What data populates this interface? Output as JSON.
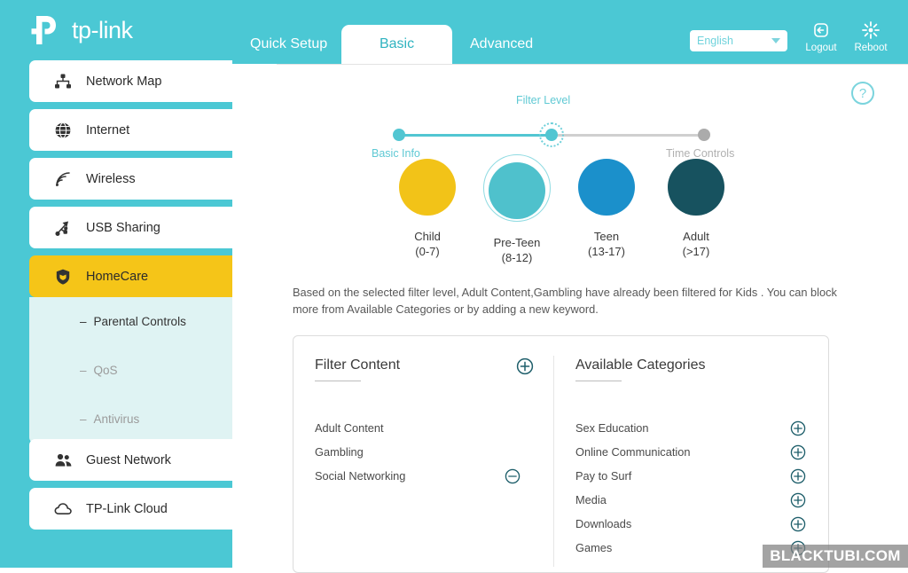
{
  "header": {
    "brand": "tp-link",
    "tabs": [
      {
        "label": "Quick Setup",
        "active": false
      },
      {
        "label": "Basic",
        "active": true
      },
      {
        "label": "Advanced",
        "active": false
      }
    ],
    "language": "English",
    "logout_label": "Logout",
    "reboot_label": "Reboot"
  },
  "sidebar": {
    "items": [
      {
        "label": "Network Map",
        "icon": "network-map-icon"
      },
      {
        "label": "Internet",
        "icon": "globe-icon"
      },
      {
        "label": "Wireless",
        "icon": "wireless-signal-icon"
      },
      {
        "label": "USB Sharing",
        "icon": "usb-icon"
      },
      {
        "label": "HomeCare",
        "icon": "shield-icon",
        "active": true
      },
      {
        "label": "Guest Network",
        "icon": "users-icon"
      },
      {
        "label": "TP-Link Cloud",
        "icon": "cloud-icon"
      }
    ],
    "submenu": [
      {
        "label": "Parental Controls",
        "active": true
      },
      {
        "label": "QoS",
        "active": false
      },
      {
        "label": "Antivirus",
        "active": false
      }
    ],
    "dash": "–"
  },
  "main": {
    "help_icon_label": "?",
    "stepper": {
      "steps": [
        {
          "label": "Basic Info",
          "state": "done"
        },
        {
          "label": "Filter Level",
          "state": "current"
        },
        {
          "label": "Time Controls",
          "state": "pending"
        }
      ]
    },
    "levels": [
      {
        "name": "Child",
        "age": "(0-7)",
        "color": "#F2C318",
        "selected": false
      },
      {
        "name": "Pre-Teen",
        "age": "(8-12)",
        "color": "#4FC1CC",
        "selected": true
      },
      {
        "name": "Teen",
        "age": "(13-17)",
        "color": "#1B90CB",
        "selected": false
      },
      {
        "name": "Adult",
        "age": "(>17)",
        "color": "#17525F",
        "selected": false
      }
    ],
    "description": "Based on the selected filter level, Adult Content,Gambling have already been filtered for Kids . You can block more from Available Categories or by adding a new keyword.",
    "filter_content": {
      "title": "Filter Content",
      "add_icon": "plus-circle-icon",
      "items": [
        {
          "label": "Adult Content",
          "action": null
        },
        {
          "label": "Gambling",
          "action": null
        },
        {
          "label": "Social Networking",
          "action": "minus-circle-icon"
        }
      ]
    },
    "available_categories": {
      "title": "Available Categories",
      "items": [
        {
          "label": "Sex Education",
          "action": "plus-circle-icon"
        },
        {
          "label": "Online Communication",
          "action": "plus-circle-icon"
        },
        {
          "label": "Pay to Surf",
          "action": "plus-circle-icon"
        },
        {
          "label": "Media",
          "action": "plus-circle-icon"
        },
        {
          "label": "Downloads",
          "action": "plus-circle-icon"
        },
        {
          "label": "Games",
          "action": "plus-circle-icon"
        }
      ]
    }
  },
  "watermark": {
    "text": "BLACKTUBI.COM"
  },
  "colors": {
    "header_teal": "#4BC8D4",
    "accent_yellow": "#F5C518",
    "submenu_bg": "#DFF3F3",
    "step_active": "#52C6D2"
  }
}
